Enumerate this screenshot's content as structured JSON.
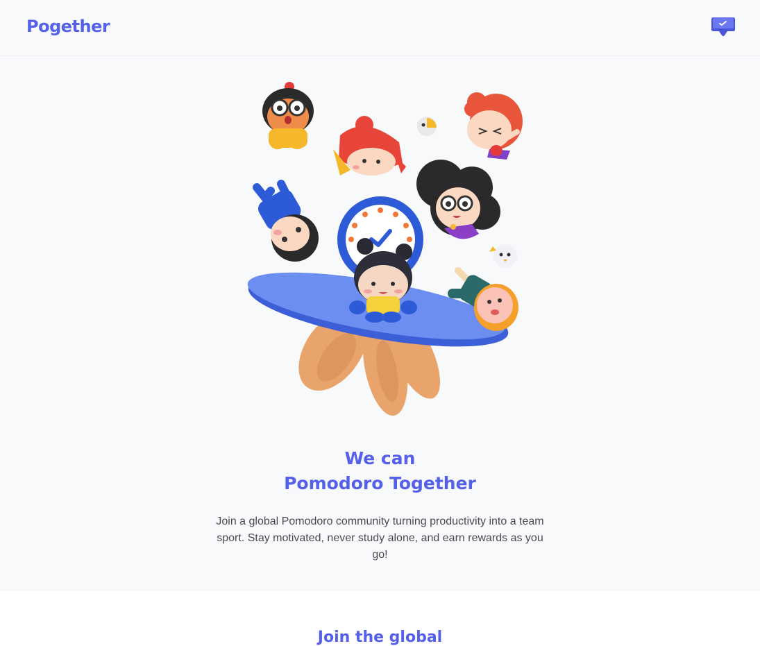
{
  "header": {
    "logo": "Pogether",
    "chat_icon": "chat-bubble-icon"
  },
  "hero": {
    "illustration": "pomodoro-characters-illustration",
    "headline_line1": "We can",
    "headline_line2": "Pomodoro Together",
    "description": "Join a global Pomodoro community turning productivity into a team sport. Stay motivated, never study alone, and earn rewards as you go!"
  },
  "section_two": {
    "title": "Join the global"
  },
  "colors": {
    "brand": "#5560e8",
    "background": "#f8f9fb",
    "text": "#4a4a52"
  }
}
